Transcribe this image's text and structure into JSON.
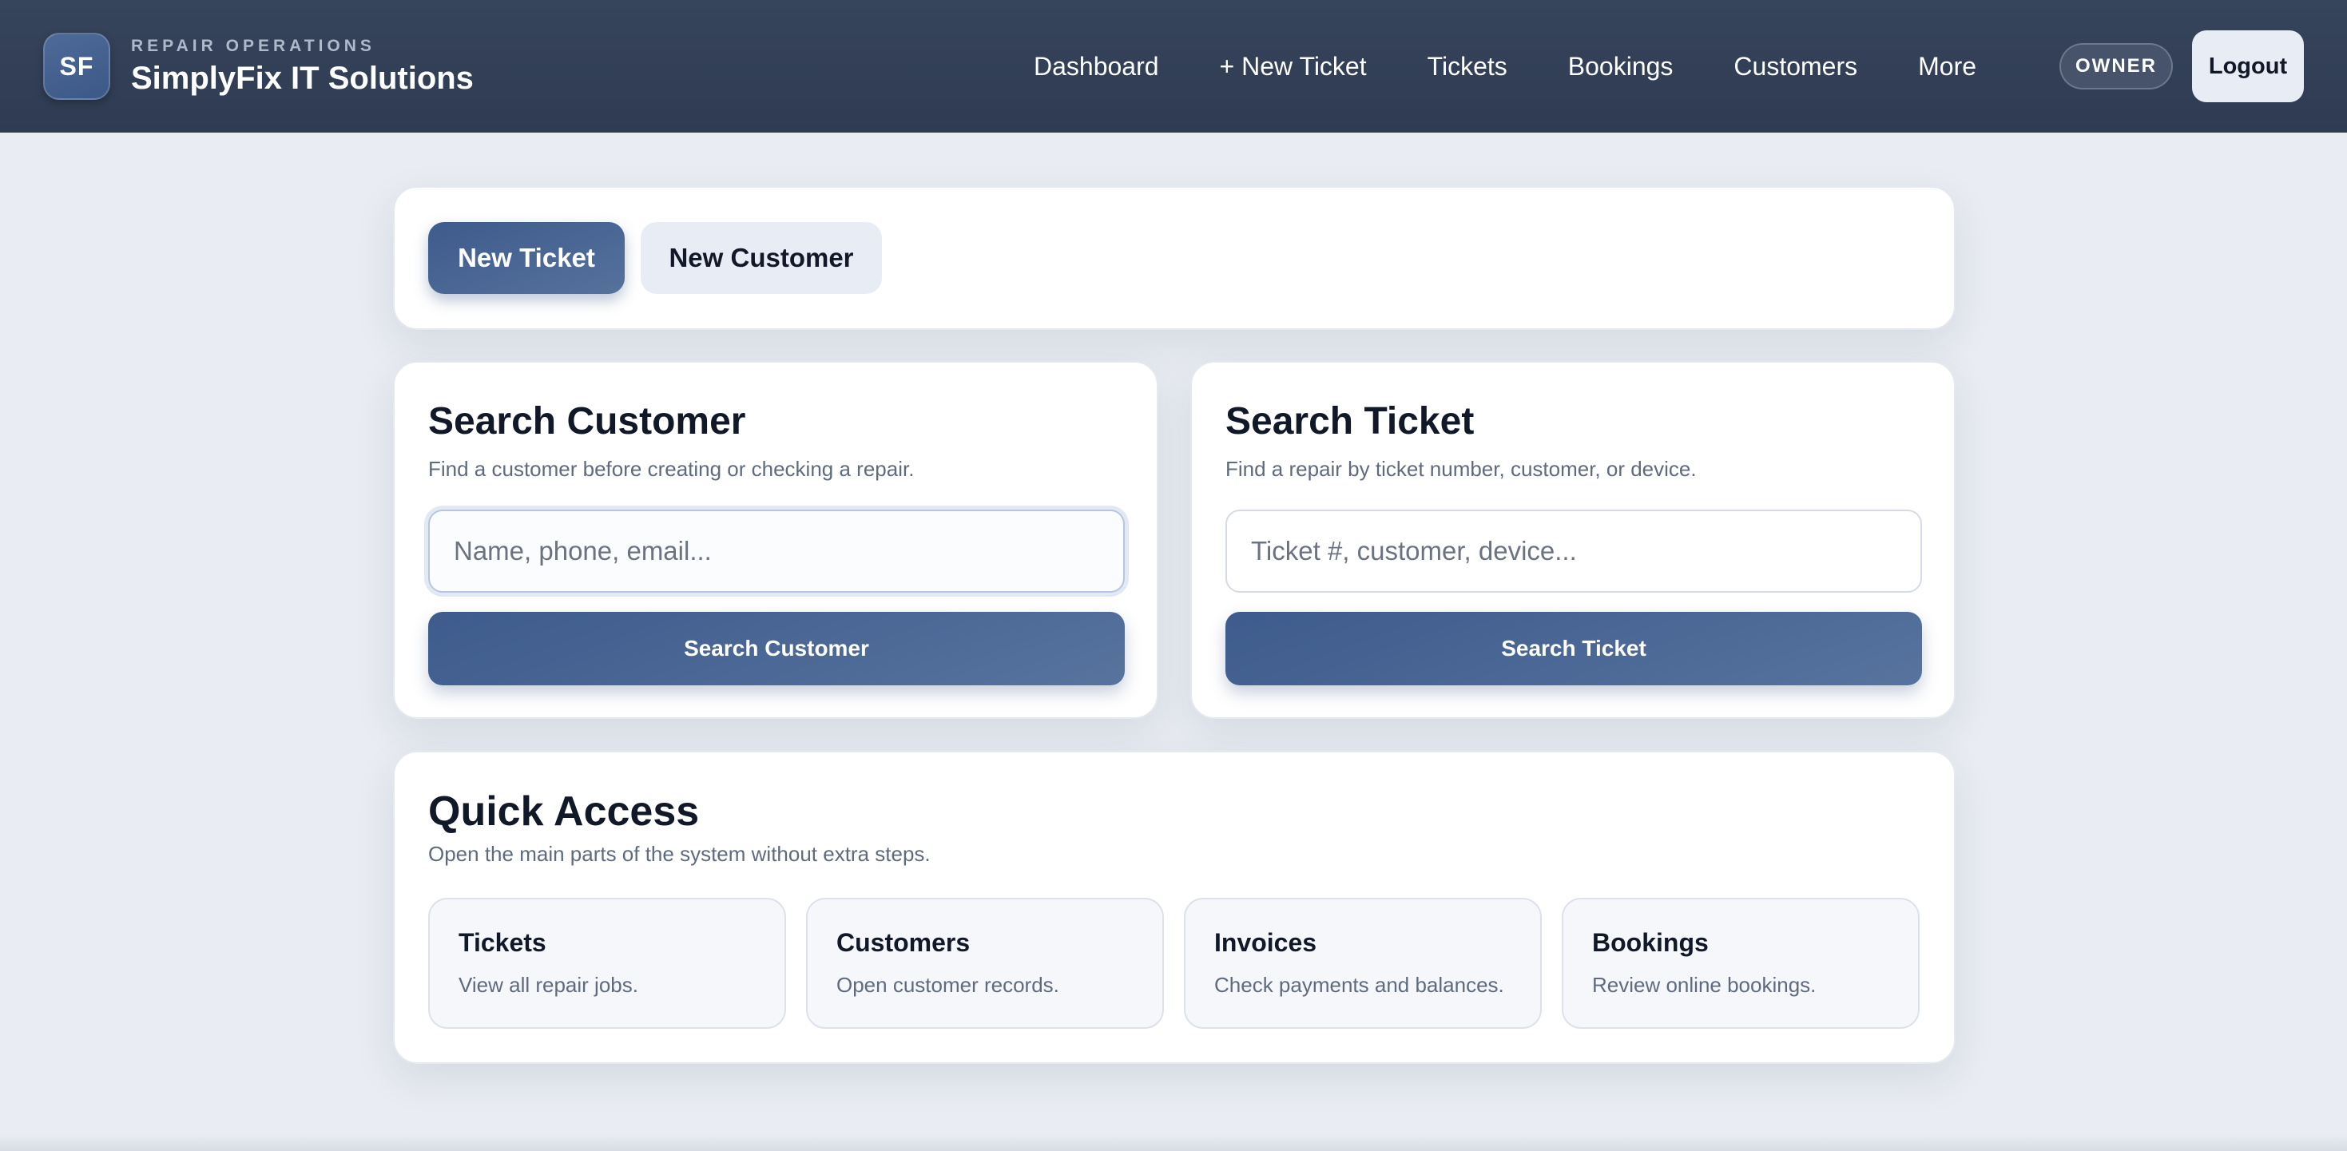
{
  "header": {
    "logo_text": "SF",
    "kicker": "REPAIR OPERATIONS",
    "brand_name": "SimplyFix IT Solutions",
    "nav": [
      {
        "label": "Dashboard"
      },
      {
        "label": "+ New Ticket"
      },
      {
        "label": "Tickets"
      },
      {
        "label": "Bookings"
      },
      {
        "label": "Customers"
      },
      {
        "label": "More"
      }
    ],
    "role_badge": "OWNER",
    "logout_label": "Logout"
  },
  "tabs": {
    "primary_label": "New Ticket",
    "secondary_label": "New Customer"
  },
  "search_customer": {
    "title": "Search Customer",
    "subtitle": "Find a customer before creating or checking a repair.",
    "placeholder": "Name, phone, email...",
    "button_label": "Search Customer"
  },
  "search_ticket": {
    "title": "Search Ticket",
    "subtitle": "Find a repair by ticket number, customer, or device.",
    "placeholder": "Ticket #, customer, device...",
    "button_label": "Search Ticket"
  },
  "quick_access": {
    "title": "Quick Access",
    "subtitle": "Open the main parts of the system without extra steps.",
    "tiles": [
      {
        "title": "Tickets",
        "subtitle": "View all repair jobs."
      },
      {
        "title": "Customers",
        "subtitle": "Open customer records."
      },
      {
        "title": "Invoices",
        "subtitle": "Check payments and balances."
      },
      {
        "title": "Bookings",
        "subtitle": "Review online bookings."
      }
    ]
  },
  "colors": {
    "header_bg": "#2f3b52",
    "accent": "#3d5b8c",
    "page_bg": "#e9ecf2"
  }
}
